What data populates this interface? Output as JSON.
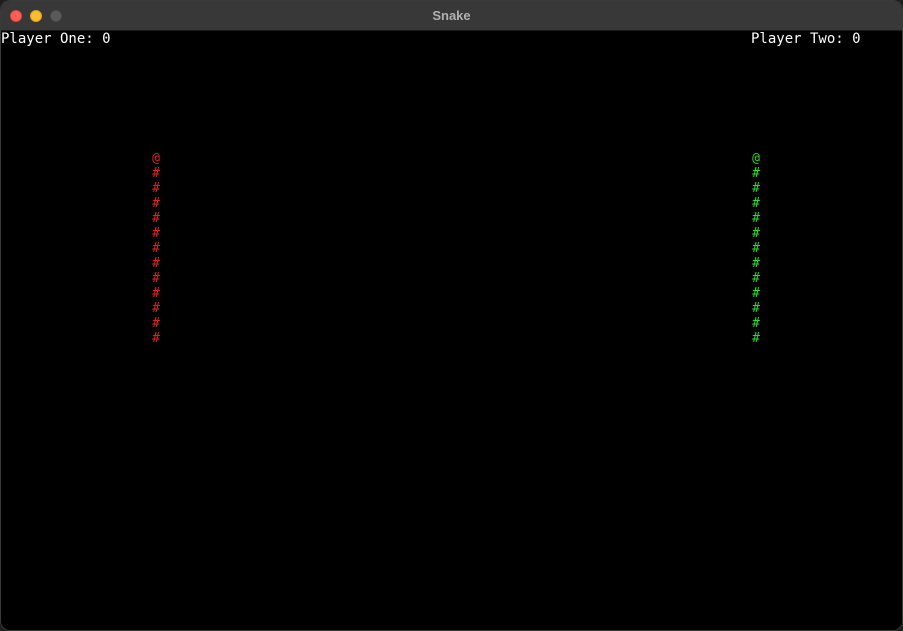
{
  "window": {
    "title": "Snake"
  },
  "scores": {
    "player_one": "Player One: 0",
    "player_two": "Player Two: 0"
  },
  "snakes": {
    "player_one": {
      "color": "#e02020",
      "head": "@",
      "body": "#",
      "body_segments": 12
    },
    "player_two": {
      "color": "#22dd22",
      "head": "@",
      "body": "#",
      "body_segments": 12
    }
  }
}
